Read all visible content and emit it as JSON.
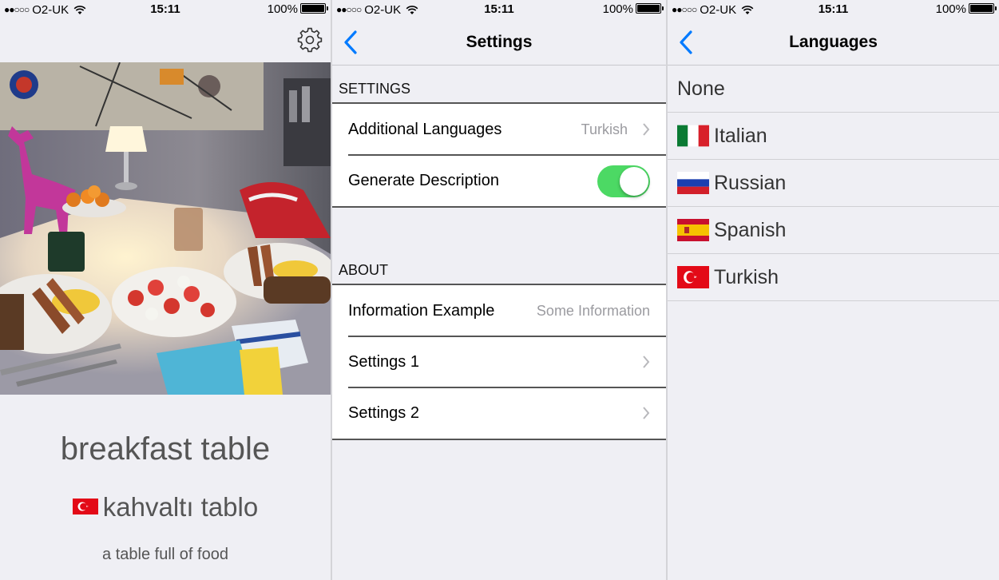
{
  "status": {
    "carrier": "O2-UK",
    "time": "15:11",
    "battery": "100%"
  },
  "detail_view": {
    "english": "breakfast table",
    "translated": "kahvaltı tablo",
    "translated_flag": "turkey-flag-icon",
    "description": "a table full of food"
  },
  "settings_view": {
    "title": "Settings",
    "sections": [
      {
        "header": "SETTINGS",
        "rows": [
          {
            "label": "Additional Languages",
            "detail": "Turkish",
            "accessory": "chevron"
          },
          {
            "label": "Generate Description",
            "toggle": true
          }
        ]
      },
      {
        "header": "ABOUT",
        "rows": [
          {
            "label": "Information Example",
            "detail": "Some Information"
          },
          {
            "label": "Settings 1",
            "accessory": "chevron"
          },
          {
            "label": "Settings 2",
            "accessory": "chevron"
          }
        ]
      }
    ]
  },
  "languages_view": {
    "title": "Languages",
    "items": [
      {
        "name": "None",
        "flag": ""
      },
      {
        "name": "Italian",
        "flag": "italy-flag-icon"
      },
      {
        "name": "Russian",
        "flag": "russia-flag-icon"
      },
      {
        "name": "Spanish",
        "flag": "spain-flag-icon"
      },
      {
        "name": "Turkish",
        "flag": "turkey-flag-icon"
      }
    ]
  },
  "colors": {
    "accent": "#007aff",
    "toggle_on": "#4cd964",
    "background": "#efeff4"
  }
}
